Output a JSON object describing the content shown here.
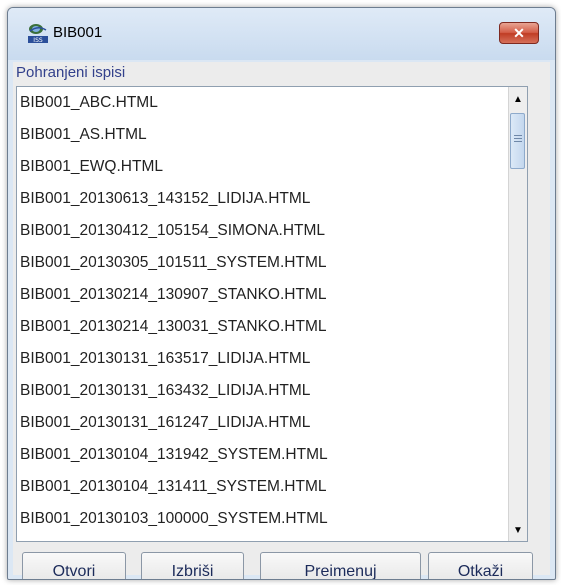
{
  "window": {
    "title": "BIB001",
    "app_icon": "iss-logo-icon",
    "close_icon": "close-icon",
    "close_glyph": "✕"
  },
  "list": {
    "label": "Pohranjeni ispisi",
    "items": [
      "BIB001_ABC.HTML",
      "BIB001_AS.HTML",
      "BIB001_EWQ.HTML",
      "BIB001_20130613_143152_LIDIJA.HTML",
      "BIB001_20130412_105154_SIMONA.HTML",
      "BIB001_20130305_101511_SYSTEM.HTML",
      "BIB001_20130214_130907_STANKO.HTML",
      "BIB001_20130214_130031_STANKO.HTML",
      "BIB001_20130131_163517_LIDIJA.HTML",
      "BIB001_20130131_163432_LIDIJA.HTML",
      "BIB001_20130131_161247_LIDIJA.HTML",
      "BIB001_20130104_131942_SYSTEM.HTML",
      "BIB001_20130104_131411_SYSTEM.HTML",
      "BIB001_20130103_100000_SYSTEM.HTML"
    ],
    "scroll_up_glyph": "▲",
    "scroll_down_glyph": "▼"
  },
  "buttons": {
    "open": "Otvori",
    "delete": "Izbriši",
    "rename": "Preimenuj",
    "cancel": "Otkaži"
  },
  "colors": {
    "frame": "#dbe7f4",
    "label": "#33418c",
    "close": "#c03c24"
  }
}
